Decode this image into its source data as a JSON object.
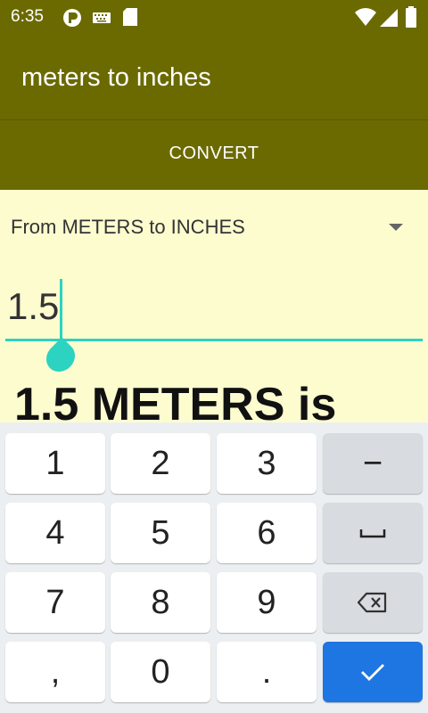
{
  "status_bar": {
    "time": "6:35",
    "icons": [
      "app-notification-icon",
      "keyboard-icon",
      "sd-card-icon",
      "wifi-icon",
      "signal-icon",
      "battery-icon"
    ]
  },
  "app_bar": {
    "title": "meters to inches"
  },
  "action": {
    "convert_label": "CONVERT"
  },
  "spinner": {
    "selected": "From METERS to INCHES"
  },
  "input": {
    "value": "1.5"
  },
  "result": {
    "text": "1.5 METERS is"
  },
  "keyboard": {
    "keys": [
      "1",
      "2",
      "3",
      "−",
      "4",
      "5",
      "6",
      "␣",
      "7",
      "8",
      "9",
      "⌫",
      ",",
      "0",
      ".",
      "✓"
    ]
  },
  "colors": {
    "primary": "#6b6a00",
    "background": "#fdfccf",
    "accent": "#2bd3c0",
    "done_key": "#1e76e2"
  }
}
